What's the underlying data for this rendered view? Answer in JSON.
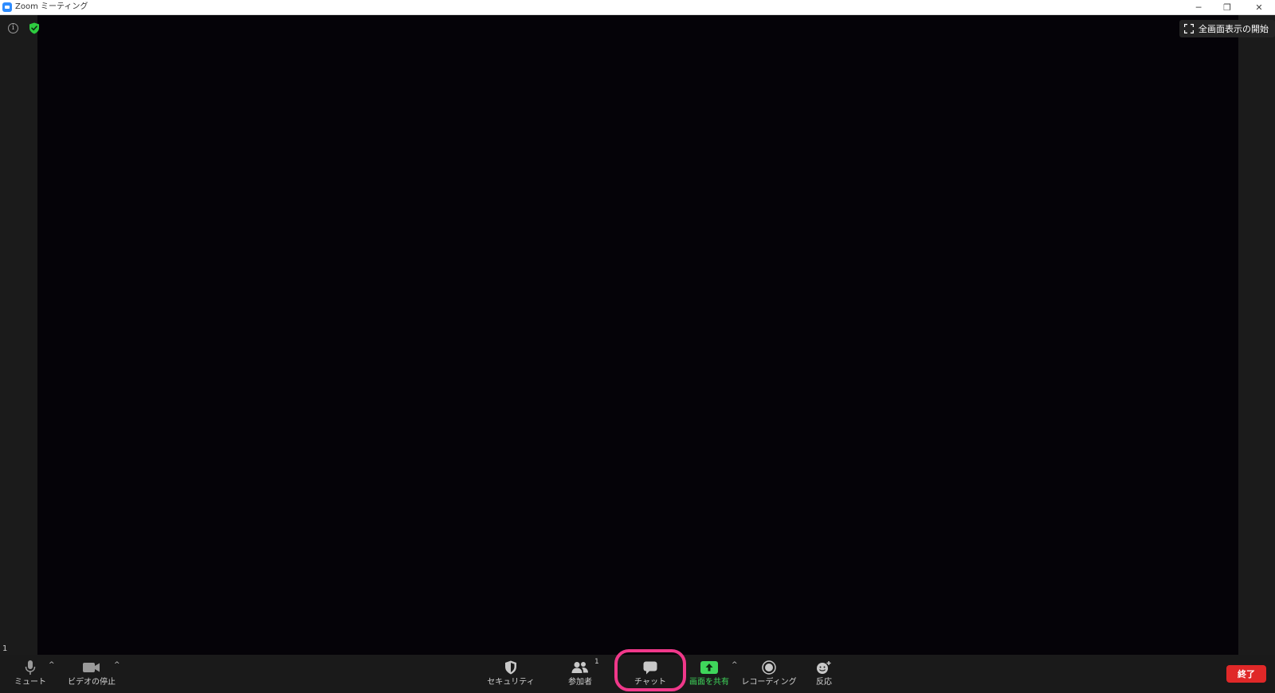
{
  "window": {
    "title": "Zoom ミーティング",
    "minimize_glyph": "─",
    "maximize_glyph": "❐",
    "close_glyph": "✕"
  },
  "meeting": {
    "info_glyph": "i",
    "fullscreen_label": "全画面表示の開始",
    "page_number": "1"
  },
  "toolbar": {
    "mute_label": "ミュート",
    "video_label": "ビデオの停止",
    "security_label": "セキュリティ",
    "participants_label": "参加者",
    "participants_count": "1",
    "chat_label": "チャット",
    "share_label": "画面を共有",
    "record_label": "レコーディング",
    "reactions_label": "反応",
    "end_label": "終了",
    "caret_glyph": "^"
  },
  "colors": {
    "share_green": "#3fd65b",
    "end_red": "#e02828",
    "highlight_pink": "#f0388a",
    "shield_green": "#2ecc40",
    "zoom_blue": "#2d8cff"
  },
  "icons": {
    "mute": "microphone-icon",
    "video": "video-camera-icon",
    "security": "shield-icon",
    "participants": "people-icon",
    "chat": "speech-bubble-icon",
    "share": "share-screen-icon",
    "record": "record-icon",
    "reactions": "smiley-add-icon",
    "fullscreen": "expand-icon"
  }
}
